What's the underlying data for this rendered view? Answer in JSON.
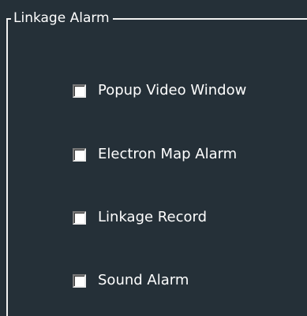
{
  "group": {
    "title": "Linkage Alarm"
  },
  "options": [
    {
      "label": "Popup Video Window",
      "checked": false
    },
    {
      "label": "Electron Map Alarm",
      "checked": false
    },
    {
      "label": "Linkage Record",
      "checked": false
    },
    {
      "label": "Sound Alarm",
      "checked": false
    }
  ],
  "colors": {
    "background": "#253038",
    "text": "#ffffff",
    "border": "#f2f2f2"
  }
}
